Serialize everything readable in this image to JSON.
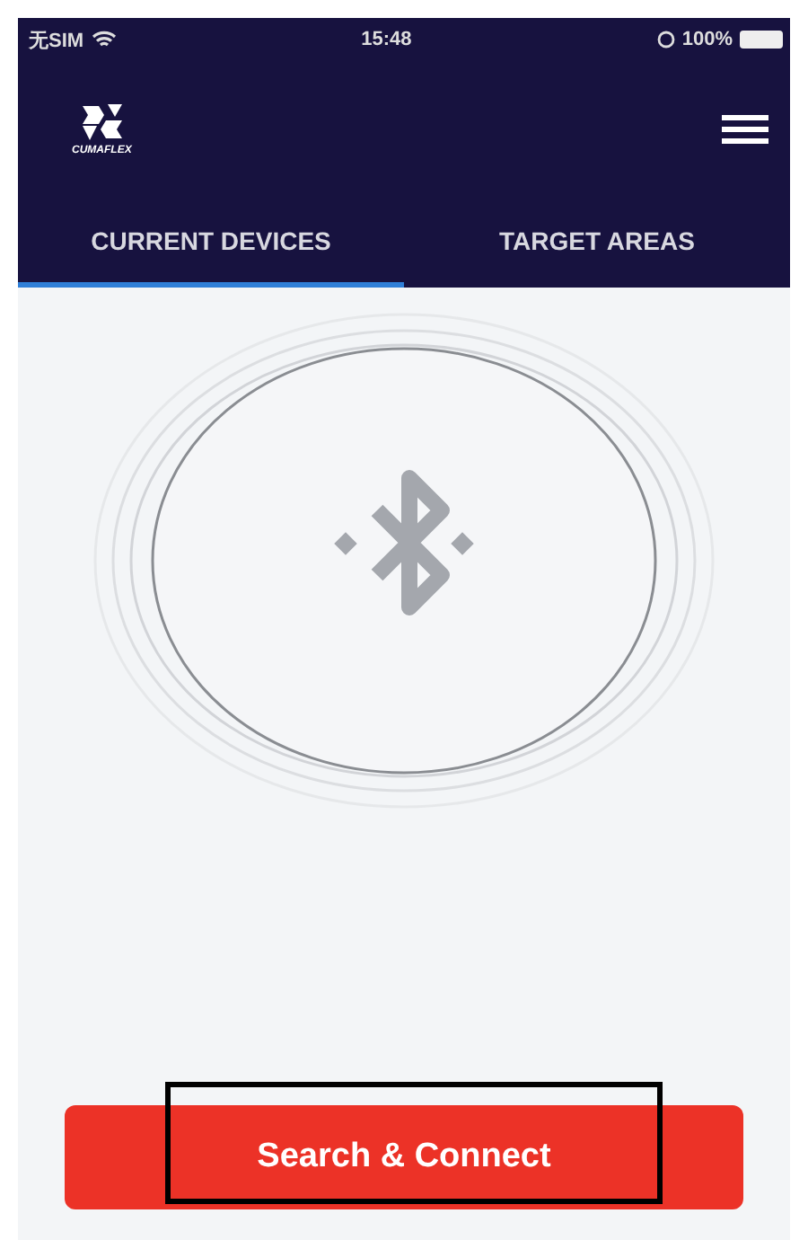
{
  "status_bar": {
    "carrier": "无SIM",
    "time": "15:48",
    "battery": "100%"
  },
  "header": {
    "logo_text": "CUMAFLEX"
  },
  "tabs": [
    {
      "label": "CURRENT DEVICES",
      "selected": true
    },
    {
      "label": "TARGET AREAS",
      "selected": false
    }
  ],
  "action_button": {
    "label": "Search & Connect",
    "highlighted": true
  }
}
